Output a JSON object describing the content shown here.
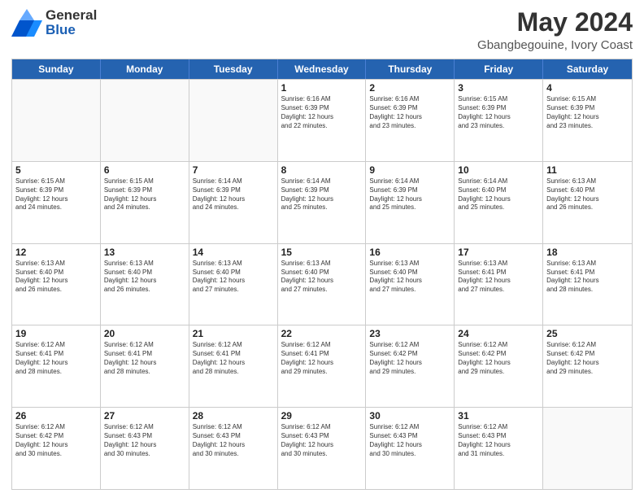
{
  "header": {
    "logo_line1": "General",
    "logo_line2": "Blue",
    "main_title": "May 2024",
    "subtitle": "Gbangbegouine, Ivory Coast"
  },
  "days_of_week": [
    "Sunday",
    "Monday",
    "Tuesday",
    "Wednesday",
    "Thursday",
    "Friday",
    "Saturday"
  ],
  "weeks": [
    [
      {
        "day": "",
        "info": ""
      },
      {
        "day": "",
        "info": ""
      },
      {
        "day": "",
        "info": ""
      },
      {
        "day": "1",
        "info": "Sunrise: 6:16 AM\nSunset: 6:39 PM\nDaylight: 12 hours\nand 22 minutes."
      },
      {
        "day": "2",
        "info": "Sunrise: 6:16 AM\nSunset: 6:39 PM\nDaylight: 12 hours\nand 23 minutes."
      },
      {
        "day": "3",
        "info": "Sunrise: 6:15 AM\nSunset: 6:39 PM\nDaylight: 12 hours\nand 23 minutes."
      },
      {
        "day": "4",
        "info": "Sunrise: 6:15 AM\nSunset: 6:39 PM\nDaylight: 12 hours\nand 23 minutes."
      }
    ],
    [
      {
        "day": "5",
        "info": "Sunrise: 6:15 AM\nSunset: 6:39 PM\nDaylight: 12 hours\nand 24 minutes."
      },
      {
        "day": "6",
        "info": "Sunrise: 6:15 AM\nSunset: 6:39 PM\nDaylight: 12 hours\nand 24 minutes."
      },
      {
        "day": "7",
        "info": "Sunrise: 6:14 AM\nSunset: 6:39 PM\nDaylight: 12 hours\nand 24 minutes."
      },
      {
        "day": "8",
        "info": "Sunrise: 6:14 AM\nSunset: 6:39 PM\nDaylight: 12 hours\nand 25 minutes."
      },
      {
        "day": "9",
        "info": "Sunrise: 6:14 AM\nSunset: 6:39 PM\nDaylight: 12 hours\nand 25 minutes."
      },
      {
        "day": "10",
        "info": "Sunrise: 6:14 AM\nSunset: 6:40 PM\nDaylight: 12 hours\nand 25 minutes."
      },
      {
        "day": "11",
        "info": "Sunrise: 6:13 AM\nSunset: 6:40 PM\nDaylight: 12 hours\nand 26 minutes."
      }
    ],
    [
      {
        "day": "12",
        "info": "Sunrise: 6:13 AM\nSunset: 6:40 PM\nDaylight: 12 hours\nand 26 minutes."
      },
      {
        "day": "13",
        "info": "Sunrise: 6:13 AM\nSunset: 6:40 PM\nDaylight: 12 hours\nand 26 minutes."
      },
      {
        "day": "14",
        "info": "Sunrise: 6:13 AM\nSunset: 6:40 PM\nDaylight: 12 hours\nand 27 minutes."
      },
      {
        "day": "15",
        "info": "Sunrise: 6:13 AM\nSunset: 6:40 PM\nDaylight: 12 hours\nand 27 minutes."
      },
      {
        "day": "16",
        "info": "Sunrise: 6:13 AM\nSunset: 6:40 PM\nDaylight: 12 hours\nand 27 minutes."
      },
      {
        "day": "17",
        "info": "Sunrise: 6:13 AM\nSunset: 6:41 PM\nDaylight: 12 hours\nand 27 minutes."
      },
      {
        "day": "18",
        "info": "Sunrise: 6:13 AM\nSunset: 6:41 PM\nDaylight: 12 hours\nand 28 minutes."
      }
    ],
    [
      {
        "day": "19",
        "info": "Sunrise: 6:12 AM\nSunset: 6:41 PM\nDaylight: 12 hours\nand 28 minutes."
      },
      {
        "day": "20",
        "info": "Sunrise: 6:12 AM\nSunset: 6:41 PM\nDaylight: 12 hours\nand 28 minutes."
      },
      {
        "day": "21",
        "info": "Sunrise: 6:12 AM\nSunset: 6:41 PM\nDaylight: 12 hours\nand 28 minutes."
      },
      {
        "day": "22",
        "info": "Sunrise: 6:12 AM\nSunset: 6:41 PM\nDaylight: 12 hours\nand 29 minutes."
      },
      {
        "day": "23",
        "info": "Sunrise: 6:12 AM\nSunset: 6:42 PM\nDaylight: 12 hours\nand 29 minutes."
      },
      {
        "day": "24",
        "info": "Sunrise: 6:12 AM\nSunset: 6:42 PM\nDaylight: 12 hours\nand 29 minutes."
      },
      {
        "day": "25",
        "info": "Sunrise: 6:12 AM\nSunset: 6:42 PM\nDaylight: 12 hours\nand 29 minutes."
      }
    ],
    [
      {
        "day": "26",
        "info": "Sunrise: 6:12 AM\nSunset: 6:42 PM\nDaylight: 12 hours\nand 30 minutes."
      },
      {
        "day": "27",
        "info": "Sunrise: 6:12 AM\nSunset: 6:43 PM\nDaylight: 12 hours\nand 30 minutes."
      },
      {
        "day": "28",
        "info": "Sunrise: 6:12 AM\nSunset: 6:43 PM\nDaylight: 12 hours\nand 30 minutes."
      },
      {
        "day": "29",
        "info": "Sunrise: 6:12 AM\nSunset: 6:43 PM\nDaylight: 12 hours\nand 30 minutes."
      },
      {
        "day": "30",
        "info": "Sunrise: 6:12 AM\nSunset: 6:43 PM\nDaylight: 12 hours\nand 30 minutes."
      },
      {
        "day": "31",
        "info": "Sunrise: 6:12 AM\nSunset: 6:43 PM\nDaylight: 12 hours\nand 31 minutes."
      },
      {
        "day": "",
        "info": ""
      }
    ]
  ]
}
